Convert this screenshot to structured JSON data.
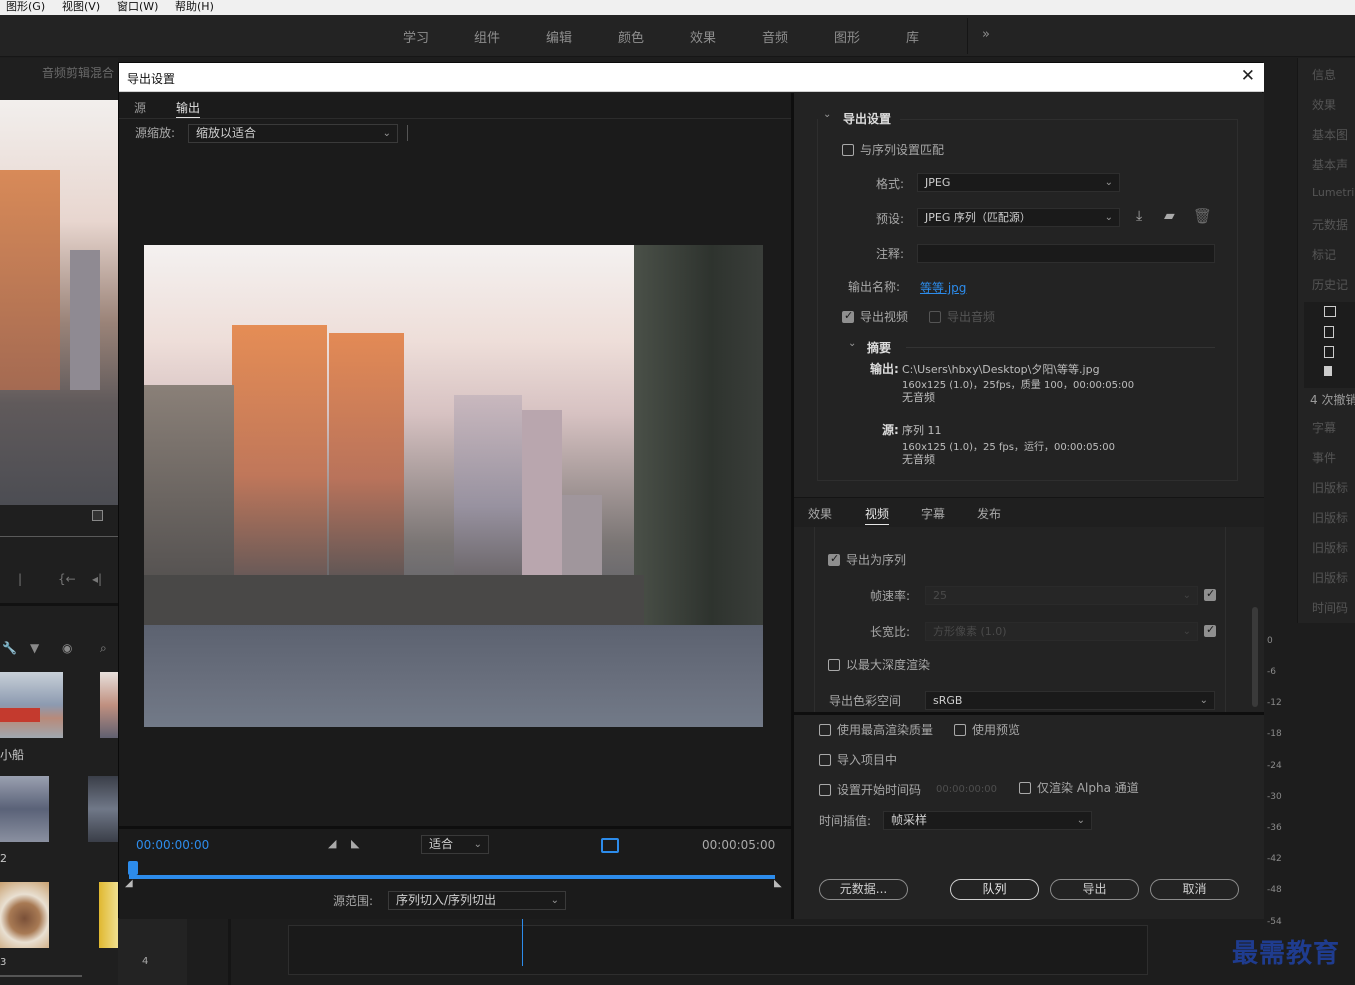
{
  "menu": [
    "图形(G)",
    "视图(V)",
    "窗口(W)",
    "帮助(H)"
  ],
  "workspaces": [
    "学习",
    "组件",
    "编辑",
    "颜色",
    "效果",
    "音频",
    "图形",
    "库"
  ],
  "workspaces_more": "»",
  "bg": {
    "audio_mixer_title": "音频剪辑混合",
    "bin_label_boat": "小船",
    "bin_label_2": "2",
    "bin_label_3": "3",
    "bin_label_4": "4",
    "right_panel_items": [
      "信息",
      "效果",
      "基本图",
      "基本声",
      "Lumetri",
      "元数据",
      "标记",
      "历史记",
      "4 次撤销",
      "字幕",
      "事件",
      "旧版标",
      "旧版标",
      "旧版标",
      "旧版标",
      "时间码"
    ],
    "meter_ticks": [
      "0",
      "-6",
      "-12",
      "-18",
      "-24",
      "-30",
      "-36",
      "-42",
      "-48",
      "-54"
    ]
  },
  "dialog": {
    "title": "导出设置",
    "close": "✕",
    "tabs": [
      "源",
      "输出"
    ],
    "active_tab": "输出",
    "source_scale_label": "源缩放:",
    "source_scale_value": "缩放以适合",
    "timecode_start": "00:00:00:00",
    "timecode_end": "00:00:05:00",
    "fit_value": "适合",
    "source_range_label": "源范围:",
    "source_range_value": "序列切入/序列切出",
    "export_settings": {
      "header": "导出设置",
      "match_sequence": "与序列设置匹配",
      "format_label": "格式:",
      "format_value": "JPEG",
      "preset_label": "预设:",
      "preset_value": "JPEG 序列（匹配源）",
      "comment_label": "注释:",
      "comment_value": "",
      "output_name_label": "输出名称:",
      "output_name_value": "等等.jpg",
      "export_video": "导出视频",
      "export_audio": "导出音频",
      "summary_header": "摘要",
      "output_label": "输出:",
      "output_path": "C:\\Users\\hbxy\\Desktop\\夕阳\\等等.jpg",
      "output_detail": "160x125 (1.0)，25fps，质量 100，00:00:05:00",
      "output_audio": "无音频",
      "source_label": "源:",
      "source_value": "序列 11",
      "source_detail": "160x125 (1.0)，25 fps，运行，00:00:05:00",
      "source_audio": "无音频"
    },
    "lower_tabs": [
      "效果",
      "视频",
      "字幕",
      "发布"
    ],
    "lower_active_tab": "视频",
    "video": {
      "export_as_sequence": "导出为序列",
      "frame_rate_label": "帧速率:",
      "frame_rate_value": "25",
      "aspect_label": "长宽比:",
      "aspect_value": "方形像素 (1.0)",
      "max_depth": "以最大深度渲染",
      "color_space_label": "导出色彩空间",
      "color_space_value": "sRGB"
    },
    "bottom": {
      "max_render_quality": "使用最高渲染质量",
      "use_previews": "使用预览",
      "import_into_project": "导入项目中",
      "set_start_timecode": "设置开始时间码",
      "start_timecode_value": "00:00:00:00",
      "render_alpha_only": "仅渲染 Alpha 通道",
      "time_interp_label": "时间插值:",
      "time_interp_value": "帧采样",
      "metadata_button": "元数据...",
      "queue_button": "队列",
      "export_button": "导出",
      "cancel_button": "取消"
    }
  },
  "watermark": "最需教育",
  "colors": {
    "accent_blue": "#2d8ceb",
    "link_blue": "#2d8ceb"
  }
}
